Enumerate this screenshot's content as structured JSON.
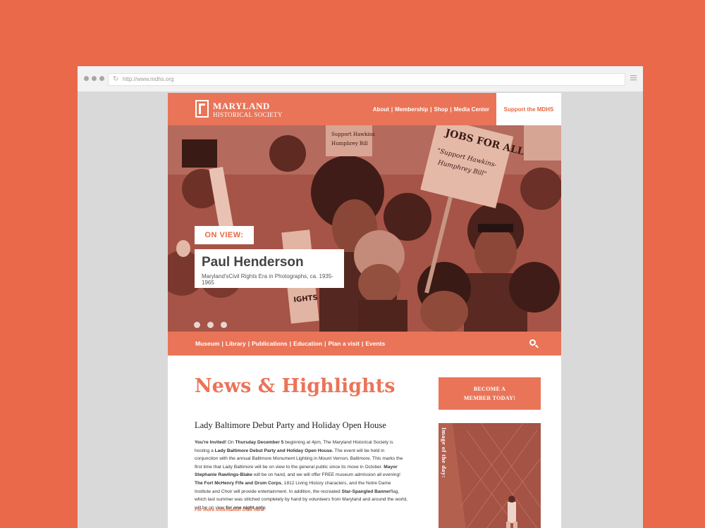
{
  "browser": {
    "url": "http://www.mdhs.org"
  },
  "header": {
    "logo_title": "MARYLAND",
    "logo_sub": "HISTORICAL SOCIETY",
    "nav": [
      "About",
      "Membership",
      "Shop",
      "Media Center"
    ],
    "support_label": "Support the MDHS"
  },
  "hero": {
    "on_view": "ON VIEW:",
    "title": "Paul Henderson",
    "subtitle": "Maryland'sCivil Rights Era in Photographs, ca. 1935-1965",
    "slides": 3,
    "signs": [
      "JOBS FOR ALL",
      "\"Support Hawkins-Humphrey Bill\"",
      "Support Hawkins Humphrey Bill",
      "RIGHTS"
    ]
  },
  "main_nav": [
    "Museum",
    "Library",
    "Publications",
    "Education",
    "Plan a visit",
    "Events"
  ],
  "news": {
    "heading": "News & Highlights",
    "article_title": "Lady Baltimore Debut Party and Holiday Open House",
    "body_parts": [
      {
        "t": "You're Invited!",
        "b": true
      },
      {
        "t": " On ",
        "b": false
      },
      {
        "t": "Thursday December 5",
        "b": true
      },
      {
        "t": " beginning at 4pm, The Maryland Historical Society is hosting a ",
        "b": false
      },
      {
        "t": "Lady Baltimore Debut Party and Holiday Open House.",
        "b": true
      },
      {
        "t": " The event will be held in conjunction with the annual Baltimore Monument Lighting in Mount Vernon, Baltimore. This marks the first time that Lady Baltimore will be on view to the general public since its move in October. ",
        "b": false
      },
      {
        "t": "Mayor Stephanie Rawlings-Blake",
        "b": true
      },
      {
        "t": " will be on hand, and we will offer FREE museum admission all evening! ",
        "b": false
      },
      {
        "t": "The Fort McHenry Fife and Drum Corps",
        "b": true
      },
      {
        "t": ", 1812 Living History characters, and the Notre Dame Institute and Choir will provide entertainment. In addition, the recreated ",
        "b": false
      },
      {
        "t": "Star-Spangled Banner",
        "b": true
      },
      {
        "t": "flag, which last summer was stitched completely by hand by volunteers from Maryland and around the world, will be on view ",
        "b": false
      },
      {
        "t": "for one night only.",
        "b": true
      }
    ],
    "more_link": "For more information click here."
  },
  "sidebar": {
    "become_line1": "BECOME A",
    "become_line2": "MEMBER TODAY!",
    "image_label": "Image of the day:"
  },
  "colors": {
    "accent": "#ea7458",
    "background": "#e9694a",
    "text": "#333333"
  }
}
